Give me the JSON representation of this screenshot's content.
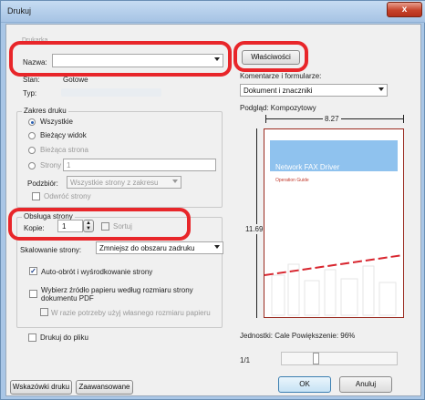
{
  "window": {
    "title": "Drukuj",
    "close_glyph": "x"
  },
  "printer": {
    "group_label": "Drukarka",
    "name_label": "Nazwa:",
    "name_value": "",
    "properties_button": "Właściwości",
    "status_label": "Stan:",
    "status_value": "Gotowe",
    "type_label": "Typ:",
    "type_value": ""
  },
  "comments": {
    "label": "Komentarze i formularze:",
    "selected": "Dokument i znaczniki"
  },
  "range": {
    "group_label": "Zakres druku",
    "options": [
      "Wszystkie",
      "Bieżący widok",
      "Bieżąca strona",
      "Strony"
    ],
    "pages_value": "1",
    "subset_label": "Podzbiór:",
    "subset_value": "Wszystkie strony z zakresu",
    "reverse_label": "Odwróć strony"
  },
  "handling": {
    "group_label": "Obsługa strony",
    "copies_label": "Kopie:",
    "copies_value": "1",
    "collate_label": "Sortuj",
    "scaling_label": "Skalowanie strony:",
    "scaling_value": "Zmniejsz do obszaru zadruku",
    "autorotate_label": "Auto-obrót i wyśrodkowanie strony",
    "source_label_1": "Wybierz źródło papieru według rozmiaru strony",
    "source_label_2": "dokumentu PDF",
    "custom_paper_label": "W razie potrzeby użyj własnego rozmiaru papieru"
  },
  "print_to_file": "Drukuj do pliku",
  "preview": {
    "label": "Podgląd: Kompozytowy",
    "width_value": "8.27",
    "height_value": "11.69",
    "doc_title": "Network FAX Driver",
    "doc_subtitle": "Operation Guide",
    "units_text": "Jednostki: Cale Powiększenie:  96%",
    "page_counter": "1/1"
  },
  "buttons": {
    "tips": "Wskazówki druku",
    "advanced": "Zaawansowane",
    "ok": "OK",
    "cancel": "Anuluj"
  },
  "colors": {
    "highlight": "#e8262a",
    "fax_banner": "#8fc2ee"
  }
}
